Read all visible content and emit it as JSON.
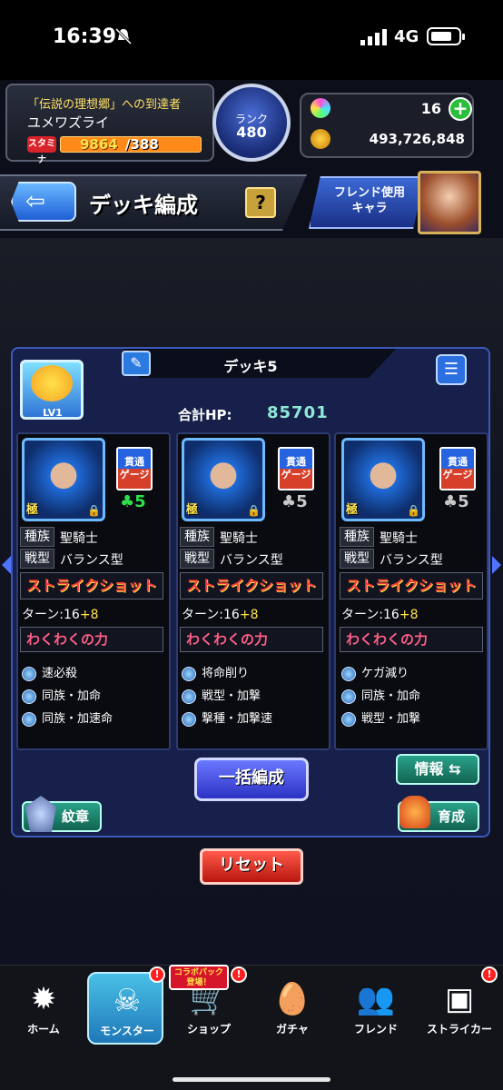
{
  "status_bar": {
    "time": "16:39",
    "network": "4G"
  },
  "player": {
    "title": "「伝説の理想郷」への到達者",
    "name": "ユメワズライ",
    "stamina_label": "スタミナ",
    "stamina_value": "9864",
    "stamina_max": "/388"
  },
  "rank": {
    "label": "ランク",
    "value": "480"
  },
  "currency": {
    "orbs": "16",
    "gold": "493,726,848"
  },
  "header": {
    "title": "デッキ編成",
    "help": "?",
    "friend_button": "フレンド使用\nキャラ"
  },
  "deck": {
    "name": "デッキ5",
    "level_label": "LV1",
    "hp_label": "合計HP:",
    "hp_value": "85701"
  },
  "monsters": [
    {
      "kanji": "極",
      "ability_badge": "貫通\nゲージ",
      "luck": "♣5",
      "luck_color": "#2fe04a",
      "tribe_label": "種族",
      "tribe": "聖騎士",
      "type_label": "戦型",
      "type": "バランス型",
      "shot": "ストライクショット",
      "turn_prefix": "ターン:16",
      "turn_plus": "+8",
      "skill": "わくわくの力",
      "abilities": [
        "速必殺",
        "同族・加命",
        "同族・加速命"
      ]
    },
    {
      "kanji": "極",
      "ability_badge": "貫通\nゲージ",
      "luck": "♣5",
      "luck_color": "#c8c8c8",
      "tribe_label": "種族",
      "tribe": "聖騎士",
      "type_label": "戦型",
      "type": "バランス型",
      "shot": "ストライクショット",
      "turn_prefix": "ターン:16",
      "turn_plus": "+8",
      "skill": "わくわくの力",
      "abilities": [
        "将命削り",
        "戦型・加撃",
        "撃種・加撃速"
      ]
    },
    {
      "kanji": "極",
      "ability_badge": "貫通\nゲージ",
      "luck": "♣5",
      "luck_color": "#c8c8c8",
      "tribe_label": "種族",
      "tribe": "聖騎士",
      "type_label": "戦型",
      "type": "バランス型",
      "shot": "ストライクショット",
      "turn_prefix": "ターン:16",
      "turn_plus": "+8",
      "skill": "わくわくの力",
      "abilities": [
        "ケガ減り",
        "同族・加命",
        "戦型・加撃"
      ]
    }
  ],
  "actions": {
    "bulk": "一括編成",
    "info": "情報 ⇆",
    "crest": "紋章",
    "grow": "育成",
    "reset": "リセット"
  },
  "nav": {
    "items": [
      "ホーム",
      "モンスター",
      "ショップ",
      "ガチャ",
      "フレンド",
      "ストライカー"
    ],
    "collab_tag": "コラボパック\n登場！",
    "badge": "!"
  }
}
